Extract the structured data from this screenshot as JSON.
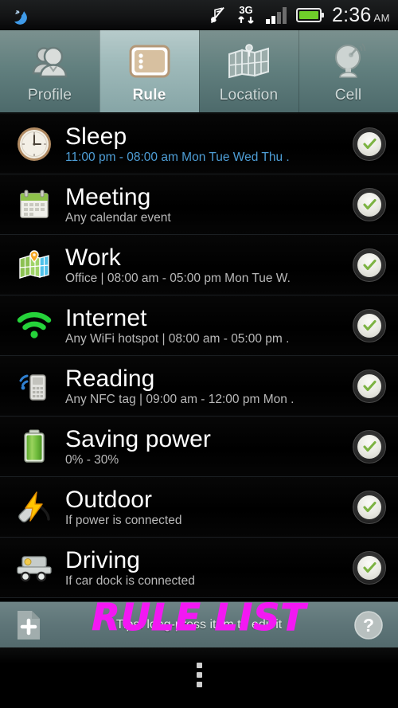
{
  "statusbar": {
    "left_icons": [
      "moon-icon"
    ],
    "right_icons": [
      "music-muted-icon",
      "3g-data-icon",
      "signal-bars-icon",
      "battery-icon"
    ],
    "network_label": "3G",
    "time": "2:36",
    "ampm": "AM"
  },
  "tabs": [
    {
      "label": "Profile",
      "icon": "people-icon",
      "selected": false
    },
    {
      "label": "Rule",
      "icon": "list-rule-icon",
      "selected": true
    },
    {
      "label": "Location",
      "icon": "map-grid-pin-icon",
      "selected": false
    },
    {
      "label": "Cell",
      "icon": "cell-antenna-icon",
      "selected": false
    }
  ],
  "rules": [
    {
      "title": "Sleep",
      "subtitle": "11:00 pm - 08:00 am  Mon Tue Wed Thu .",
      "subtitle_highlight": true,
      "icon": "clock-icon",
      "enabled": true
    },
    {
      "title": "Meeting",
      "subtitle": "Any calendar event",
      "subtitle_highlight": false,
      "icon": "calendar-icon",
      "enabled": true
    },
    {
      "title": "Work",
      "subtitle": "Office | 08:00 am - 05:00 pm Mon Tue W.",
      "subtitle_highlight": false,
      "icon": "map-pin-icon",
      "enabled": true
    },
    {
      "title": "Internet",
      "subtitle": "Any WiFi hotspot | 08:00 am - 05:00 pm .",
      "subtitle_highlight": false,
      "icon": "wifi-icon",
      "enabled": true
    },
    {
      "title": "Reading",
      "subtitle": "Any NFC tag | 09:00 am - 12:00 pm Mon .",
      "subtitle_highlight": false,
      "icon": "nfc-phone-icon",
      "enabled": true
    },
    {
      "title": "Saving power",
      "subtitle": "0% - 30%",
      "subtitle_highlight": false,
      "icon": "battery-icon",
      "enabled": true
    },
    {
      "title": "Outdoor",
      "subtitle": "If power is connected",
      "subtitle_highlight": false,
      "icon": "power-plug-icon",
      "enabled": true
    },
    {
      "title": "Driving",
      "subtitle": "If car dock is connected",
      "subtitle_highlight": false,
      "icon": "car-dock-icon",
      "enabled": true
    }
  ],
  "bottombar": {
    "add_icon": "add-page-icon",
    "tip": "Tips: long-press item to edit it",
    "help_icon": "help-icon"
  },
  "navbar": {
    "menu_icon": "overflow-menu-icon"
  },
  "overlay": {
    "text": "RULE LIST",
    "color": "#f318f3"
  },
  "colors": {
    "accent_blue": "#4e9ed6",
    "check_green": "#7cb342",
    "tab_selected_bg": "#9fbaba",
    "bottom_bar_bg": "#5e7578"
  }
}
